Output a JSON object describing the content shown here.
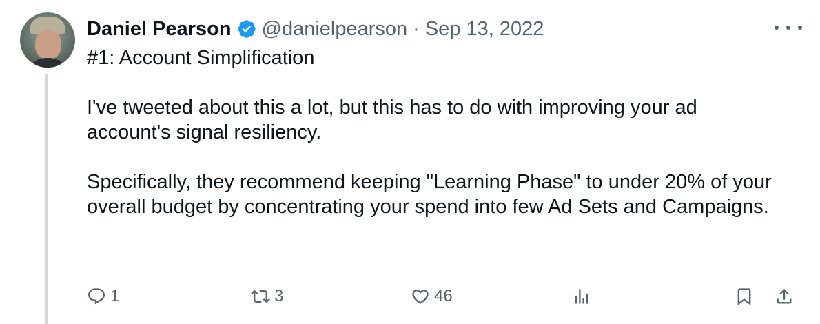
{
  "tweet": {
    "author_name": "Daniel Pearson",
    "handle": "@danielpearson",
    "separator": "·",
    "date": "Sep 13, 2022",
    "paragraphs": [
      "#1: Account Simplification",
      "I've tweeted about this a lot, but this has to do with improving your ad account's signal resiliency.",
      "Specifically, they recommend keeping \"Learning Phase\" to under 20% of your overall budget by concentrating your spend into few Ad Sets and Campaigns."
    ],
    "verified_color": "#1d9bf0"
  },
  "actions": {
    "replies": "1",
    "retweets": "3",
    "likes": "46"
  },
  "colors": {
    "text": "#0f1419",
    "secondary": "#536471",
    "thread_line": "#cfd9de"
  }
}
